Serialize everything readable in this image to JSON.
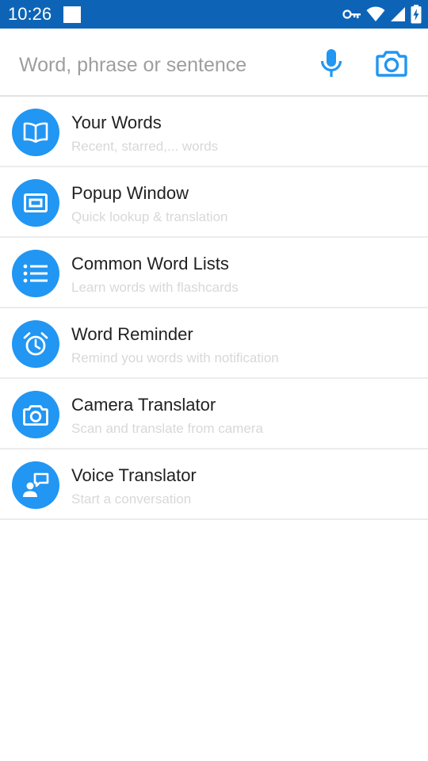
{
  "status_bar": {
    "time": "10:26"
  },
  "search": {
    "placeholder": "Word, phrase or sentence",
    "value": ""
  },
  "menu": {
    "items": [
      {
        "title": "Your Words",
        "subtitle": "Recent, starred,... words",
        "icon": "book-icon"
      },
      {
        "title": "Popup Window",
        "subtitle": "Quick lookup & translation",
        "icon": "popup-window-icon"
      },
      {
        "title": "Common Word Lists",
        "subtitle": "Learn words with flashcards",
        "icon": "list-icon"
      },
      {
        "title": "Word Reminder",
        "subtitle": "Remind you words with notification",
        "icon": "alarm-clock-icon"
      },
      {
        "title": "Camera Translator",
        "subtitle": "Scan and translate from camera",
        "icon": "camera-icon"
      },
      {
        "title": "Voice Translator",
        "subtitle": "Start a conversation",
        "icon": "voice-chat-icon"
      }
    ]
  },
  "colors": {
    "status_bar": "#0d64b6",
    "accent": "#2196f3",
    "title_text": "#212121",
    "subtitle_text": "#d8d8d8",
    "divider": "#ececec"
  }
}
